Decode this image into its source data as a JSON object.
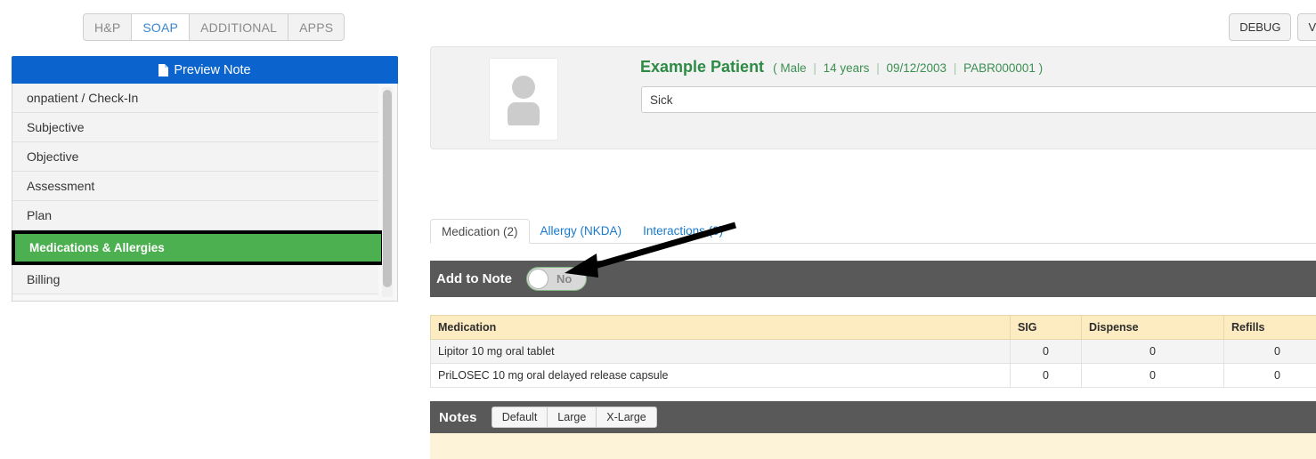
{
  "topnav": {
    "tabs": [
      {
        "label": "H&P",
        "active": false
      },
      {
        "label": "SOAP",
        "active": true
      },
      {
        "label": "ADDITIONAL",
        "active": false
      },
      {
        "label": "APPS",
        "active": false
      }
    ]
  },
  "topright": {
    "buttons": [
      {
        "label": "DEBUG"
      },
      {
        "label": "Vie"
      }
    ]
  },
  "sidebar": {
    "preview_label": "Preview Note",
    "preview_icon": "document-icon",
    "accent_blue": "#0b63ce",
    "selected_green": "#4caf50",
    "items": [
      {
        "label": "onpatient / Check-In",
        "selected": false
      },
      {
        "label": "Subjective",
        "selected": false
      },
      {
        "label": "Objective",
        "selected": false
      },
      {
        "label": "Assessment",
        "selected": false
      },
      {
        "label": "Plan",
        "selected": false
      },
      {
        "label": "Medications & Allergies",
        "selected": true
      },
      {
        "label": "Billing",
        "selected": false
      }
    ]
  },
  "patient": {
    "name": "Example Patient",
    "open_paren": "(",
    "sex": "Male",
    "age": "14 years",
    "dob": "09/12/2003",
    "mrn": "PABR000001",
    "close_paren": ")",
    "separator": "|",
    "reason_value": "Sick",
    "reason_placeholder": "",
    "avatar_icon": "person-placeholder-icon",
    "name_color": "#2e8b45"
  },
  "content_tabs": [
    {
      "label": "Medication (2)",
      "active": true
    },
    {
      "label": "Allergy (NKDA)",
      "active": false
    },
    {
      "label": "Interactions (0)",
      "active": false
    }
  ],
  "add_to_note": {
    "label": "Add to Note",
    "toggle_value": "No",
    "bar_color": "#595959"
  },
  "medication_table": {
    "columns": [
      "Medication",
      "SIG",
      "Dispense",
      "Refills"
    ],
    "rows": [
      {
        "medication": "Lipitor 10 mg oral tablet",
        "sig": "0",
        "dispense": "0",
        "refills": "0"
      },
      {
        "medication": "PriLOSEC 10 mg oral delayed release capsule",
        "sig": "0",
        "dispense": "0",
        "refills": "0"
      }
    ],
    "header_color": "#fdecc2"
  },
  "notes": {
    "title": "Notes",
    "size_buttons": [
      "Default",
      "Large",
      "X-Large"
    ],
    "body_color": "#fdf3d8"
  },
  "annotation": {
    "arrow_name": "pointer-arrow-to-toggle"
  }
}
